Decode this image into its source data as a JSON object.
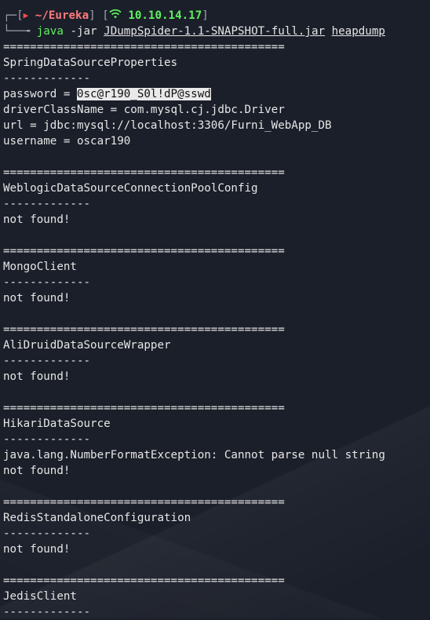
{
  "prompt": {
    "path": "~/Eureka",
    "ip": "10.10.14.17",
    "command": "java",
    "flag": "-jar",
    "jar_file": "JDumpSpider-1.1-SNAPSHOT-full.jar",
    "dump_file": "heapdump"
  },
  "separator_long": "==========================================",
  "separator_short": "-------------",
  "sections": {
    "spring": {
      "title": "SpringDataSourceProperties",
      "password_label": "password = ",
      "password_value": "0sc@r190_S0l!dP@sswd",
      "driver": "driverClassName = com.mysql.cj.jdbc.Driver",
      "url": "url = jdbc:mysql://localhost:3306/Furni_WebApp_DB",
      "username": "username = oscar190"
    },
    "weblogic": {
      "title": "WeblogicDataSourceConnectionPoolConfig",
      "result": "not found!"
    },
    "mongo": {
      "title": "MongoClient",
      "result": "not found!"
    },
    "alidruid": {
      "title": "AliDruidDataSourceWrapper",
      "result": "not found!"
    },
    "hikari": {
      "title": "HikariDataSource",
      "exception": "java.lang.NumberFormatException: Cannot parse null string",
      "result": "not found!"
    },
    "redis": {
      "title": "RedisStandaloneConfiguration",
      "result": "not found!"
    },
    "jedis": {
      "title": "JedisClient"
    }
  },
  "icons": {
    "skull": "skull-icon",
    "wifi": "wifi-icon"
  },
  "colors": {
    "background": "#1b1f2a",
    "text": "#e6e6e6",
    "prompt_path": "#ff7a7a",
    "prompt_ip": "#5ff05f",
    "command": "#5ff05f",
    "highlight_bg": "#e9e9e9"
  }
}
